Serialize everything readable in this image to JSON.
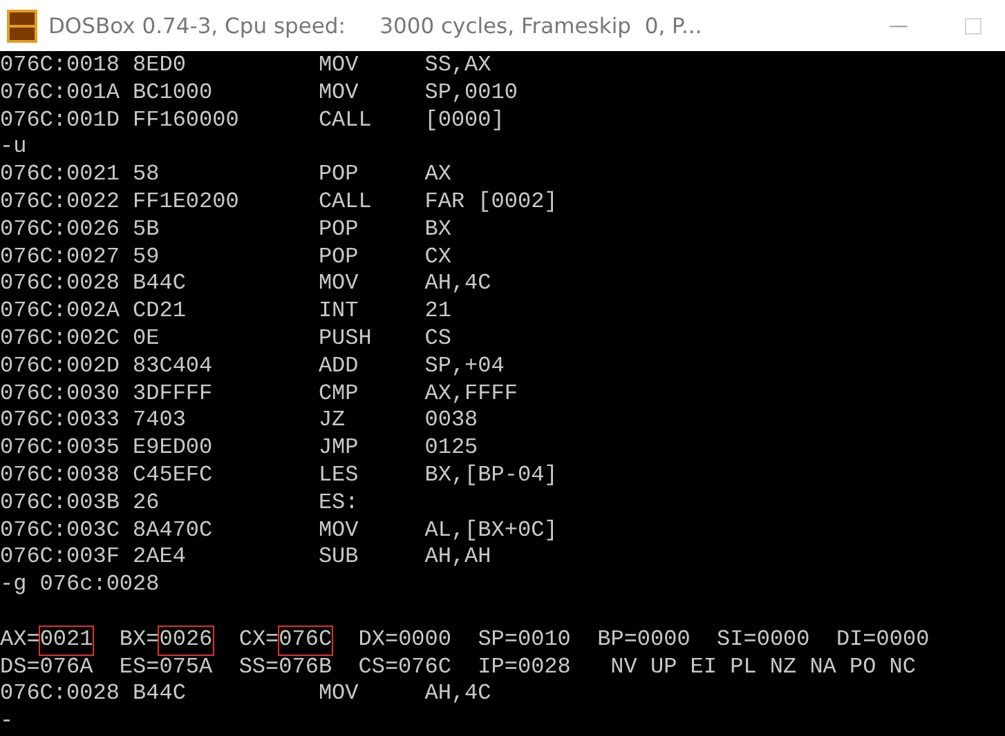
{
  "window": {
    "title": "DOSBox 0.74-3, Cpu speed:     3000 cycles, Frameskip  0, P...",
    "minimize": "—",
    "maximize_disabled": true
  },
  "console": [
    {
      "kind": "text",
      "text": "076C:0018 8ED0          MOV     SS,AX"
    },
    {
      "kind": "text",
      "text": "076C:001A BC1000        MOV     SP,0010"
    },
    {
      "kind": "text",
      "text": "076C:001D FF160000      CALL    [0000]"
    },
    {
      "kind": "text",
      "text": "-u"
    },
    {
      "kind": "text",
      "text": "076C:0021 58            POP     AX"
    },
    {
      "kind": "text",
      "text": "076C:0022 FF1E0200      CALL    FAR [0002]"
    },
    {
      "kind": "text",
      "text": "076C:0026 5B            POP     BX"
    },
    {
      "kind": "text",
      "text": "076C:0027 59            POP     CX"
    },
    {
      "kind": "text",
      "text": "076C:0028 B44C          MOV     AH,4C"
    },
    {
      "kind": "text",
      "text": "076C:002A CD21          INT     21"
    },
    {
      "kind": "text",
      "text": "076C:002C 0E            PUSH    CS"
    },
    {
      "kind": "text",
      "text": "076C:002D 83C404        ADD     SP,+04"
    },
    {
      "kind": "text",
      "text": "076C:0030 3DFFFF        CMP     AX,FFFF"
    },
    {
      "kind": "text",
      "text": "076C:0033 7403          JZ      0038"
    },
    {
      "kind": "text",
      "text": "076C:0035 E9ED00        JMP     0125"
    },
    {
      "kind": "text",
      "text": "076C:0038 C45EFC        LES     BX,[BP-04]"
    },
    {
      "kind": "text",
      "text": "076C:003B 26            ES:"
    },
    {
      "kind": "text",
      "text": "076C:003C 8A470C        MOV     AL,[BX+0C]"
    },
    {
      "kind": "text",
      "text": "076C:003F 2AE4          SUB     AH,AH"
    },
    {
      "kind": "text",
      "text": "-g 076c:0028"
    },
    {
      "kind": "blank"
    },
    {
      "kind": "registers",
      "items": [
        {
          "name": "AX=",
          "value": "0021",
          "highlighted": true
        },
        {
          "name": "BX=",
          "value": "0026",
          "highlighted": true
        },
        {
          "name": "CX=",
          "value": "076C",
          "highlighted": true
        },
        {
          "name": "DX=",
          "value": "0000",
          "highlighted": false
        },
        {
          "name": "SP=",
          "value": "0010",
          "highlighted": false
        },
        {
          "name": "BP=",
          "value": "0000",
          "highlighted": false
        },
        {
          "name": "SI=",
          "value": "0000",
          "highlighted": false
        },
        {
          "name": "DI=",
          "value": "0000",
          "highlighted": false
        }
      ]
    },
    {
      "kind": "text",
      "text": "DS=076A  ES=075A  SS=076B  CS=076C  IP=0028   NV UP EI PL NZ NA PO NC"
    },
    {
      "kind": "text",
      "text": "076C:0028 B44C          MOV     AH,4C"
    },
    {
      "kind": "text",
      "text": "-"
    }
  ]
}
